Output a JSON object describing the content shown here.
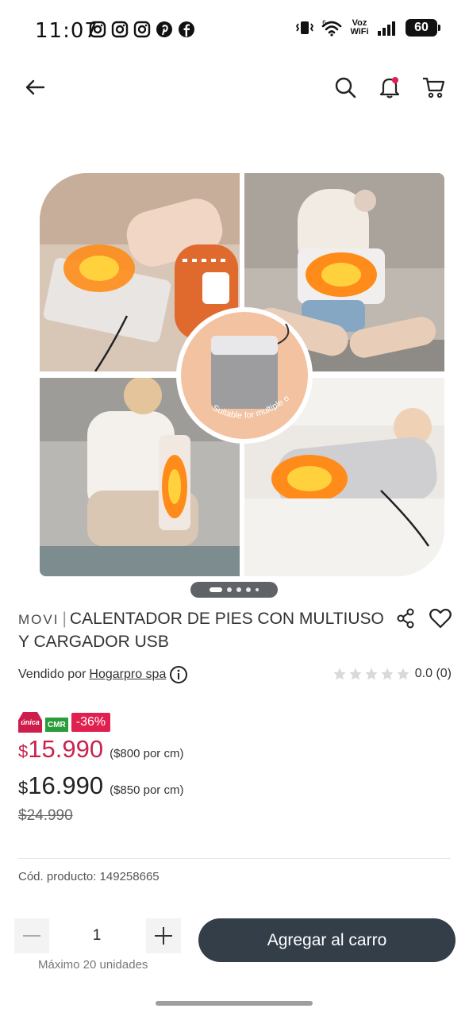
{
  "status_bar": {
    "time": "11:07",
    "notification_icons": [
      "instagram-icon",
      "instagram-icon",
      "instagram-icon",
      "pinterest-icon",
      "facebook-icon"
    ],
    "voz_wifi": "Voz WiFi",
    "network": "6",
    "battery": "60"
  },
  "product": {
    "brand": "MOVI",
    "title": "CALENTADOR DE PIES CON MULTIUSO Y CARGADOR USB",
    "image_caption": "Suitable for multiple occasions",
    "image_count": 5,
    "image_active_index": 0,
    "seller_label": "Vendido por",
    "seller_name": "Hogarpro spa",
    "rating": "0.0 (0)",
    "badge_unica": "única",
    "badge_cmr": "CMR",
    "discount": "-36%",
    "currency": "$",
    "price_cmr": "15.990",
    "price_cmr_unit": "($800 por cm)",
    "price_normal": "16.990",
    "price_normal_unit": "($850 por cm)",
    "price_old": "$24.990",
    "code": "Cód. producto: 149258665"
  },
  "cart": {
    "quantity": "1",
    "max_label": "Máximo 20 unidades",
    "add_label": "Agregar al carro"
  },
  "colors": {
    "price_accent": "#c7254e",
    "button_bg": "#343e48",
    "discount_badge": "#e0204f",
    "cmr_green": "#2a9d3a"
  }
}
